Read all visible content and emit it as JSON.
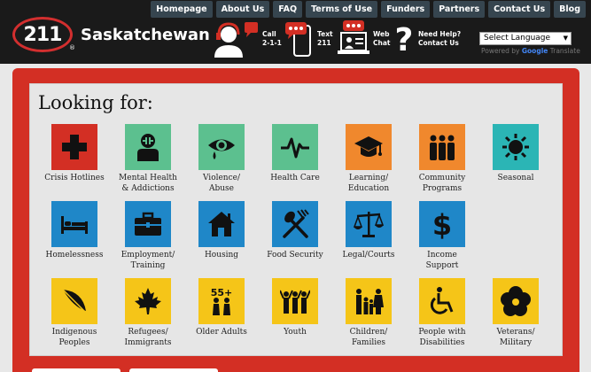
{
  "brand": {
    "logo_text": "211",
    "reg": "®",
    "name": "Saskatchewan"
  },
  "nav": [
    "Homepage",
    "About Us",
    "FAQ",
    "Terms of Use",
    "Funders",
    "Partners",
    "Contact Us",
    "Blog"
  ],
  "contacts": {
    "call": {
      "line1": "Call",
      "line2": "2-1-1"
    },
    "text": {
      "line1": "Text",
      "line2": "211"
    },
    "chat": {
      "line1": "Web",
      "line2": "Chat"
    },
    "help": {
      "line1": "Need Help?",
      "line2": "Contact Us"
    }
  },
  "language": {
    "selected": "Select Language",
    "powered_prefix": "Powered by",
    "google": "Google",
    "translate": "Translate"
  },
  "heading": "Looking for:",
  "categories": [
    {
      "label": "Crisis Hotlines",
      "color": "#d32f24",
      "icon": "cross-icon"
    },
    {
      "label": "Mental Health\n& Addictions",
      "color": "#5cc08f",
      "icon": "person-plus-icon"
    },
    {
      "label": "Violence/\nAbuse",
      "color": "#5cc08f",
      "icon": "eye-tear-icon"
    },
    {
      "label": "Health Care",
      "color": "#5cc08f",
      "icon": "heartbeat-icon"
    },
    {
      "label": "Learning/\nEducation",
      "color": "#f0882d",
      "icon": "graduation-cap-icon"
    },
    {
      "label": "Community\nPrograms",
      "color": "#f0882d",
      "icon": "group-icon"
    },
    {
      "label": "Seasonal",
      "color": "#2bb5b5",
      "icon": "sun-icon"
    },
    {
      "label": "Homelessness",
      "color": "#1f87c8",
      "icon": "bed-icon"
    },
    {
      "label": "Employment/\nTraining",
      "color": "#1f87c8",
      "icon": "briefcase-icon"
    },
    {
      "label": "Housing",
      "color": "#1f87c8",
      "icon": "house-icon"
    },
    {
      "label": "Food Security",
      "color": "#1f87c8",
      "icon": "fork-spoon-icon"
    },
    {
      "label": "Legal/Courts",
      "color": "#1f87c8",
      "icon": "scales-icon"
    },
    {
      "label": "Income\nSupport",
      "color": "#1f87c8",
      "icon": "dollar-icon"
    },
    {
      "label": "Indigenous\nPeoples",
      "color": "#f5c518",
      "icon": "feather-icon"
    },
    {
      "label": "Refugees/\nImmigrants",
      "color": "#f5c518",
      "icon": "maple-leaf-icon"
    },
    {
      "label": "Older Adults",
      "color": "#f5c518",
      "icon": "seniors-55-icon"
    },
    {
      "label": "Youth",
      "color": "#f5c518",
      "icon": "youth-icon"
    },
    {
      "label": "Children/\nFamilies",
      "color": "#f5c518",
      "icon": "family-icon"
    },
    {
      "label": "People with\nDisabilities",
      "color": "#f5c518",
      "icon": "wheelchair-icon"
    },
    {
      "label": "Veterans/\nMilitary",
      "color": "#f5c518",
      "icon": "poppy-icon"
    }
  ],
  "seniors_badge": "55+"
}
